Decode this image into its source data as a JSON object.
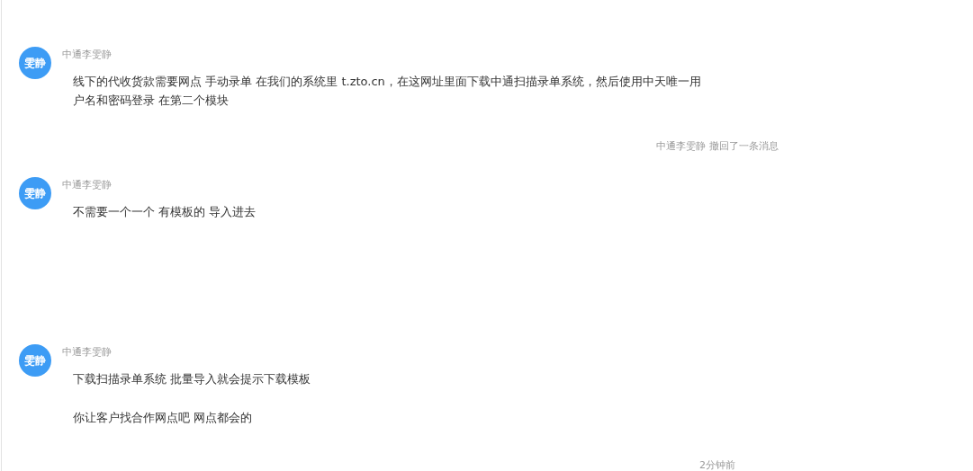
{
  "items": [
    {
      "kind": "message",
      "avatar": "雯静",
      "sender": "中通李雯静",
      "paragraphs": [
        "线下的代收货款需要网点  手动录单 在我们的系统里 t.zto.cn，在这网址里面下载中通扫描录单系统，然后使用中天唯一用户名和密码登录 在第二个模块"
      ]
    },
    {
      "kind": "notice",
      "text": "中通李雯静 撤回了一条消息"
    },
    {
      "kind": "message",
      "avatar": "雯静",
      "sender": "中通李雯静",
      "paragraphs": [
        "不需要一个一个 有模板的  导入进去"
      ]
    },
    {
      "kind": "message",
      "avatar": "雯静",
      "sender": "中通李雯静",
      "paragraphs": [
        "下载扫描录单系统 批量导入就会提示下载模板",
        "你让客户找合作网点吧 网点都会的"
      ]
    },
    {
      "kind": "time",
      "text": "2分钟前"
    }
  ]
}
